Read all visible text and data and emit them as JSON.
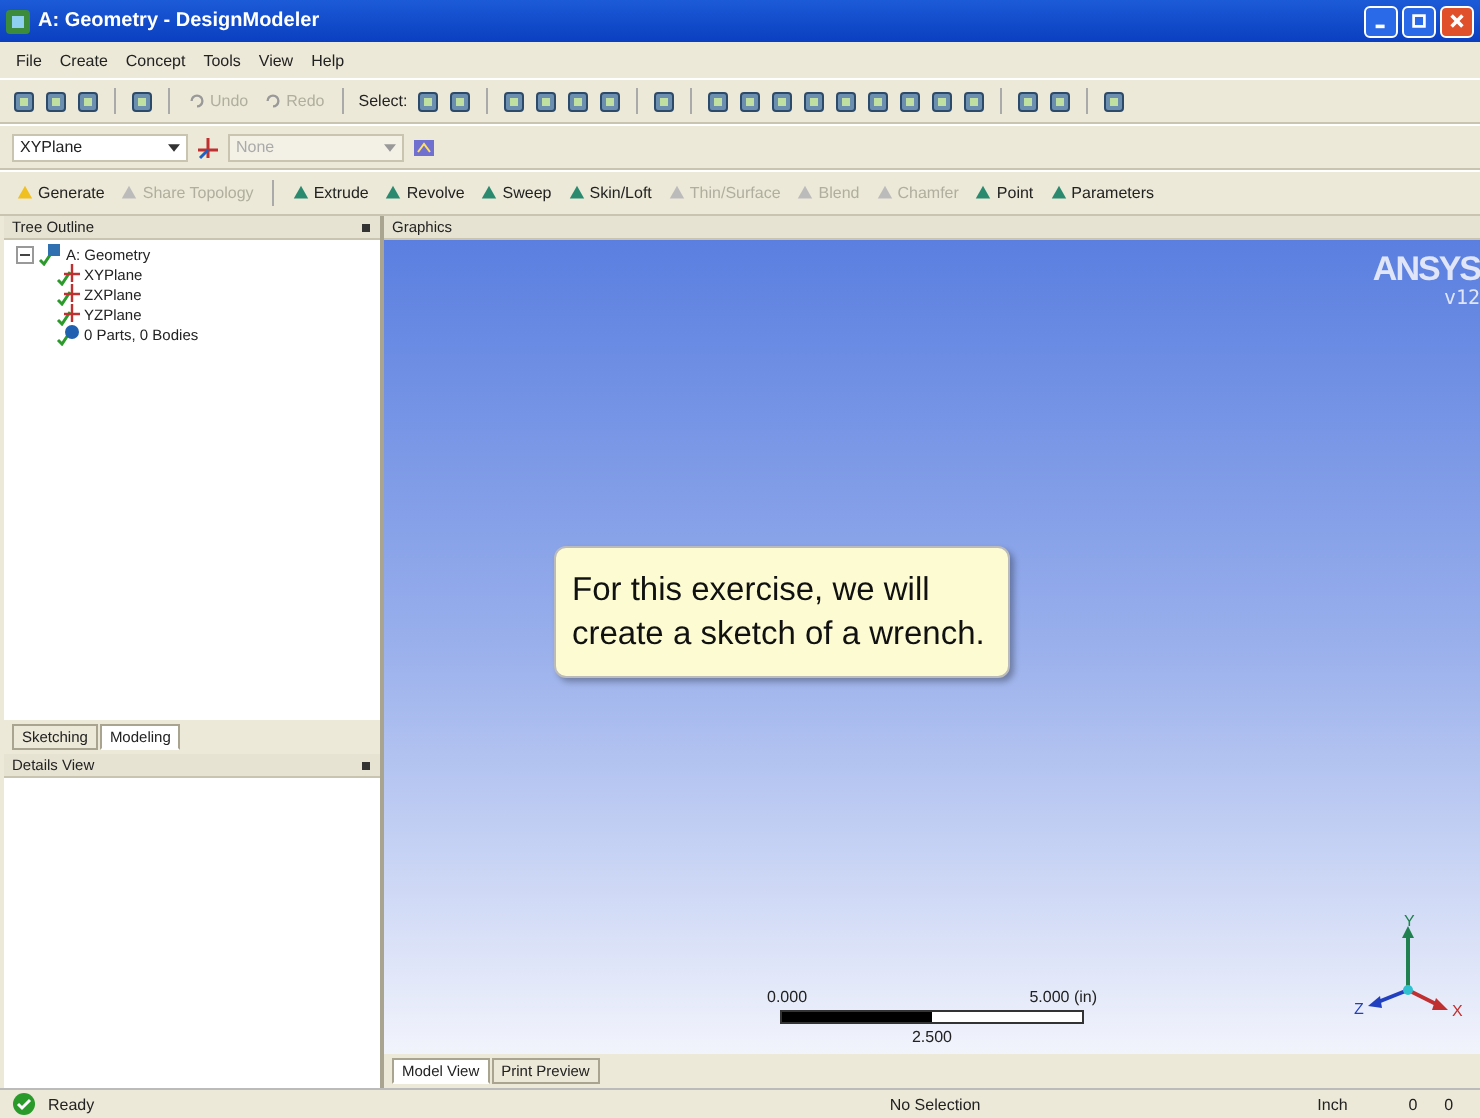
{
  "window": {
    "title": "A: Geometry - DesignModeler"
  },
  "menu": [
    "File",
    "Create",
    "Concept",
    "Tools",
    "View",
    "Help"
  ],
  "toolbar_1": [
    {
      "kind": "icon"
    },
    {
      "kind": "icon"
    },
    {
      "kind": "icon"
    },
    {
      "kind": "sep"
    },
    {
      "kind": "icon"
    },
    {
      "kind": "sep"
    },
    {
      "kind": "button",
      "label": "Undo",
      "disabled": true
    },
    {
      "kind": "button",
      "label": "Redo",
      "disabled": true
    },
    {
      "kind": "sep"
    },
    {
      "kind": "text",
      "label": "Select:"
    },
    {
      "kind": "icon"
    },
    {
      "kind": "icon"
    },
    {
      "kind": "sep"
    },
    {
      "kind": "icon"
    },
    {
      "kind": "icon"
    },
    {
      "kind": "icon"
    },
    {
      "kind": "icon"
    },
    {
      "kind": "sep"
    },
    {
      "kind": "icon"
    },
    {
      "kind": "sep"
    },
    {
      "kind": "icon"
    },
    {
      "kind": "icon"
    },
    {
      "kind": "icon"
    },
    {
      "kind": "icon"
    },
    {
      "kind": "icon"
    },
    {
      "kind": "icon"
    },
    {
      "kind": "icon"
    },
    {
      "kind": "icon"
    },
    {
      "kind": "icon"
    },
    {
      "kind": "sep"
    },
    {
      "kind": "icon"
    },
    {
      "kind": "icon"
    },
    {
      "kind": "sep"
    },
    {
      "kind": "icon"
    }
  ],
  "plane_bar": {
    "plane": "XYPlane",
    "sketch": "None",
    "sketch_disabled": true
  },
  "toolbar_2": [
    {
      "label": "Generate",
      "disabled": false
    },
    {
      "label": "Share Topology",
      "disabled": true
    },
    {
      "label": "Extrude",
      "disabled": false
    },
    {
      "label": "Revolve",
      "disabled": false
    },
    {
      "label": "Sweep",
      "disabled": false
    },
    {
      "label": "Skin/Loft",
      "disabled": false
    },
    {
      "label": "Thin/Surface",
      "disabled": true
    },
    {
      "label": "Blend",
      "disabled": true
    },
    {
      "label": "Chamfer",
      "disabled": true
    },
    {
      "label": "Point",
      "disabled": false
    },
    {
      "label": "Parameters",
      "disabled": false
    }
  ],
  "tree_outline": {
    "title": "Tree Outline",
    "items": [
      {
        "label": "A: Geometry",
        "expanded": true,
        "children": [
          {
            "label": "XYPlane"
          },
          {
            "label": "ZXPlane"
          },
          {
            "label": "YZPlane"
          },
          {
            "label": "0 Parts, 0 Bodies"
          }
        ]
      }
    ]
  },
  "panel_tabs": [
    {
      "label": "Sketching",
      "selected": false
    },
    {
      "label": "Modeling",
      "selected": true
    }
  ],
  "details_view": {
    "title": "Details View"
  },
  "graphics": {
    "title": "Graphics",
    "logo": "ANSYS",
    "version": "v12",
    "callout": "For this exercise, we will create a sketch of a wrench.",
    "scale": {
      "start": "0.000",
      "end": "5.000 (in)",
      "middle": "2.500"
    },
    "axes": {
      "x": "X",
      "y": "Y",
      "z": "Z"
    }
  },
  "view_tabs": [
    {
      "label": "Model View",
      "selected": true
    },
    {
      "label": "Print Preview",
      "selected": false
    }
  ],
  "status_bar": {
    "message": "Ready",
    "selection": "No Selection",
    "units": "Inch",
    "field_1": "0",
    "field_2": "0"
  }
}
